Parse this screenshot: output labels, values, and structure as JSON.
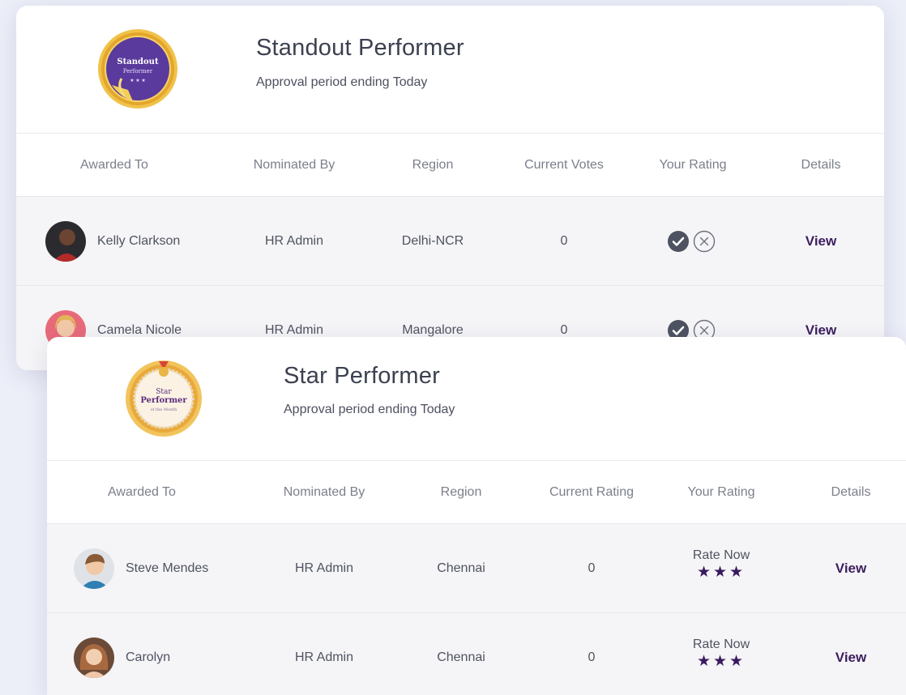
{
  "cards": [
    {
      "title": "Standout Performer",
      "subtitle": "Approval period ending Today",
      "badge": {
        "line1": "Standout",
        "line2": "Performer"
      },
      "columns": [
        "Awarded To",
        "Nominated By",
        "Region",
        "Current Votes",
        "Your Rating",
        "Details"
      ],
      "rows": [
        {
          "name": "Kelly Clarkson",
          "nominated_by": "HR Admin",
          "region": "Delhi-NCR",
          "value": "0",
          "details": "View"
        },
        {
          "name": "Camela Nicole",
          "nominated_by": "HR Admin",
          "region": "Mangalore",
          "value": "0",
          "details": "View"
        }
      ]
    },
    {
      "title": "Star Performer",
      "subtitle": "Approval period ending Today",
      "badge": {
        "line1": "Star",
        "line2": "Performer",
        "line3": "of the Month"
      },
      "columns": [
        "Awarded To",
        "Nominated By",
        "Region",
        "Current Rating",
        "Your Rating",
        "Details"
      ],
      "rows": [
        {
          "name": "Steve Mendes",
          "nominated_by": "HR Admin",
          "region": "Chennai",
          "value": "0",
          "rating_label": "Rate Now",
          "stars": "★★★",
          "details": "View"
        },
        {
          "name": "Carolyn",
          "nominated_by": "HR Admin",
          "region": "Chennai",
          "value": "0",
          "rating_label": "Rate Now",
          "stars": "★★★",
          "details": "View"
        }
      ]
    }
  ],
  "colors": {
    "accent_purple": "#3d1e5e",
    "approve_icon": "#4d5360",
    "background": "#eceef8"
  },
  "icons": [
    "approve-check-icon",
    "reject-x-icon",
    "star-icon"
  ]
}
